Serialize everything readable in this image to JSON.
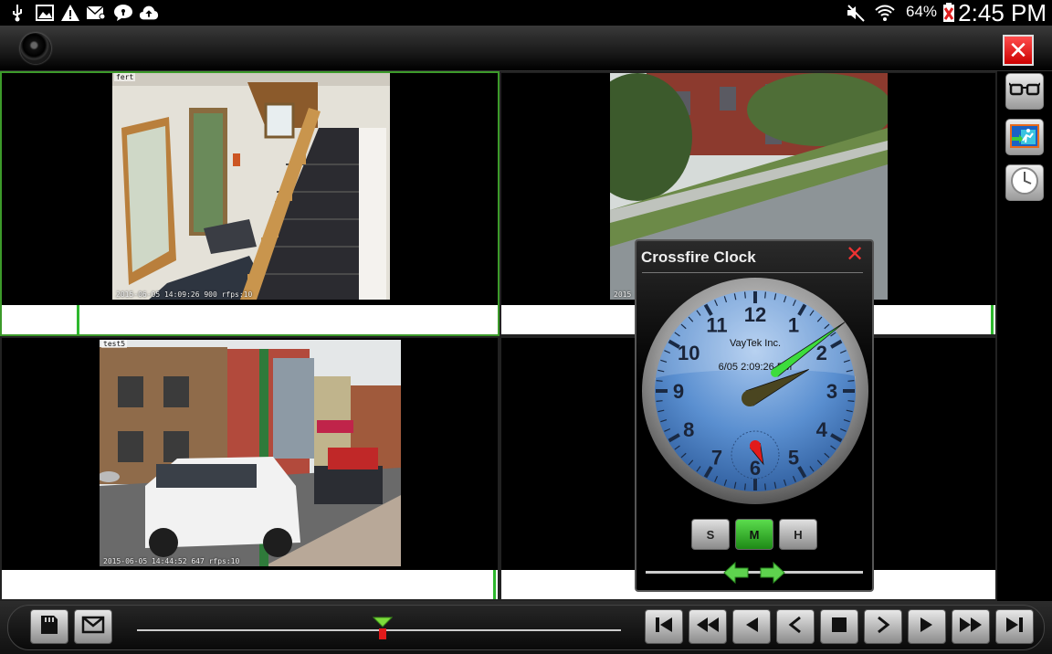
{
  "status_bar": {
    "battery": "64%",
    "time": "2:45 PM",
    "icons": [
      "usb-icon",
      "image-icon",
      "warning-icon",
      "email-icon",
      "chat-icon",
      "cloud-upload-icon",
      "mute-icon",
      "wifi-icon",
      "battery-icon"
    ]
  },
  "feeds": [
    {
      "label": "fert",
      "timestamp": "2015-06-05 14:09:26 900  rfps:10"
    },
    {
      "label": "",
      "timestamp": "2015"
    },
    {
      "label": "test5",
      "timestamp": "2015-06-05 14:44:52 647  rfps:10"
    },
    {
      "label": "",
      "timestamp": ""
    }
  ],
  "clock": {
    "title": "Crossfire Clock",
    "brand": "VayTek Inc.",
    "datetime": "6/05 2:09:26 PM",
    "numbers": [
      "12",
      "1",
      "2",
      "3",
      "4",
      "5",
      "6",
      "7",
      "8",
      "9",
      "10",
      "11"
    ],
    "hour_hand_angle": 64,
    "minute_hand_angle": 54,
    "second_hand_angle": 156,
    "mode_buttons": [
      "S",
      "M",
      "H"
    ],
    "active_mode": "M",
    "colors": {
      "face": "#5a8fd0",
      "minute": "#3ddc3d",
      "hour": "#4a4520",
      "second": "#e21b1b"
    }
  },
  "timeline": {
    "position": 0.5
  },
  "colors": {
    "selected_border": "#3c9a2a",
    "accent_green": "#2eb82e",
    "close_red": "#e02020"
  }
}
